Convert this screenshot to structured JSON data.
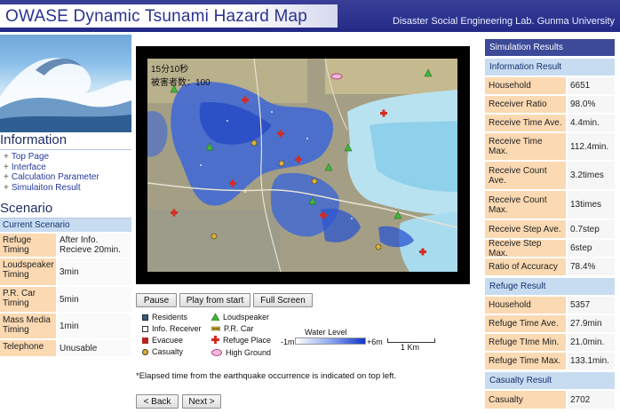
{
  "header": {
    "title": "OWASE Dynamic Tsunami Hazard Map",
    "lab": "Disaster Social Engineering Lab. Gunma University"
  },
  "colors": {
    "header_bg": "#272d8b",
    "key_bg": "#fbd9b2",
    "section_head_bg": "#c7dcf1",
    "dark_head_bg": "#3c4a99"
  },
  "information": {
    "heading": "Information",
    "links": [
      "Top Page",
      "Interface",
      "Calculation Parameter",
      "Simulaiton Result"
    ]
  },
  "scenario": {
    "heading": "Scenario",
    "current_title": "Current Scenario",
    "rows": [
      {
        "key": "Refuge Timing",
        "value": "After Info. Recieve 20min."
      },
      {
        "key": "Loudspeaker Timing",
        "value": "3min"
      },
      {
        "key": "P.R. Car Timing",
        "value": "5min"
      },
      {
        "key": "Mass Media Timing",
        "value": "1min"
      },
      {
        "key": "Telephone",
        "value": "Unusable"
      }
    ]
  },
  "map": {
    "elapsed": "15分10秒",
    "victims": "被害者数：100"
  },
  "controls": {
    "pause": "Pause",
    "play": "Play from start",
    "fullscreen": "Full Screen"
  },
  "legend": {
    "residents": "Residents",
    "info_receiver": "Info. Receiver",
    "evacuee": "Evacuee",
    "casualty": "Casualty",
    "loudspeaker": "Loudspeaker",
    "pr_car": "P.R. Car",
    "refuge_place": "Refuge Place",
    "high_ground": "High Ground",
    "water_level": "Water Level",
    "water_min": "-1m",
    "water_max": "+6m",
    "scale": "1 Km"
  },
  "note": "*Elapsed time from the earthquake occurrence is indicated on top left.",
  "pager": {
    "back": "< Back",
    "next": "Next >"
  },
  "results": {
    "title": "Simulation Results",
    "info_title": "Information Result",
    "info_rows": [
      {
        "key": "Household",
        "value": "6651"
      },
      {
        "key": "Receiver Ratio",
        "value": "98.0%"
      },
      {
        "key": "Receive Time Ave.",
        "value": "4.4min."
      },
      {
        "key": "Receive Time Max.",
        "value": "112.4min."
      },
      {
        "key": "Receive Count Ave.",
        "value": "3.2times"
      },
      {
        "key": "Receive Count Max.",
        "value": "13times"
      },
      {
        "key": "Receive Step Ave.",
        "value": "0.7step"
      },
      {
        "key": "Receive Step Max.",
        "value": "6step"
      },
      {
        "key": "Ratio of Accuracy",
        "value": "78.4%"
      }
    ],
    "refuge_title": "Refuge Result",
    "refuge_rows": [
      {
        "key": "Household",
        "value": "5357"
      },
      {
        "key": "Refuge Time Ave.",
        "value": "27.9min"
      },
      {
        "key": "Refuge TIme Min.",
        "value": "21.0min."
      },
      {
        "key": "Refuge Time Max.",
        "value": "133.1min."
      }
    ],
    "casualty_title": "Casualty Result",
    "casualty_rows": [
      {
        "key": "Casualty",
        "value": "2702"
      }
    ]
  }
}
